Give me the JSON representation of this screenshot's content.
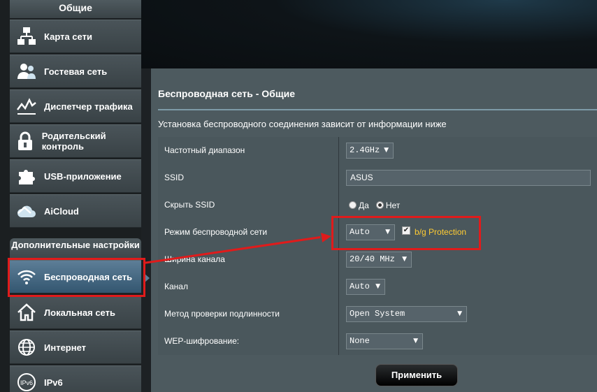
{
  "sidebar": {
    "general_header": "Общие",
    "general_items": [
      {
        "label": "Карта сети",
        "icon": "network-map-icon"
      },
      {
        "label": "Гостевая сеть",
        "icon": "guest-network-icon"
      },
      {
        "label": "Диспетчер трафика",
        "icon": "traffic-manager-icon"
      },
      {
        "label": "Родительский контроль",
        "icon": "lock-icon"
      },
      {
        "label": "USB-приложение",
        "icon": "puzzle-icon"
      },
      {
        "label": "AiCloud",
        "icon": "cloud-icon"
      }
    ],
    "advanced_header": "Дополнительные настройки",
    "advanced_items": [
      {
        "label": "Беспроводная сеть",
        "icon": "wifi-icon",
        "active": true
      },
      {
        "label": "Локальная сеть",
        "icon": "home-icon"
      },
      {
        "label": "Интернет",
        "icon": "globe-icon"
      },
      {
        "label": "IPv6",
        "icon": "ipv6-icon"
      }
    ]
  },
  "panel": {
    "title": "Беспроводная сеть - Общие",
    "description": "Установка беспроводного соединения зависит от информации ниже",
    "rows": {
      "band": {
        "label": "Частотный диапазон",
        "value": "2.4GHz"
      },
      "ssid": {
        "label": "SSID",
        "value": "ASUS"
      },
      "hide_ssid": {
        "label": "Скрыть SSID",
        "option_yes": "Да",
        "option_no": "Нет",
        "selected": "Нет"
      },
      "mode": {
        "label": "Режим беспроводной сети",
        "value": "Auto",
        "protection_label": "b/g Protection",
        "protection_checked": true
      },
      "width": {
        "label": "Ширина канала",
        "value": "20/40 MHz"
      },
      "channel": {
        "label": "Канал",
        "value": "Auto"
      },
      "auth": {
        "label": "Метод проверки подлинности",
        "value": "Open System"
      },
      "wep": {
        "label": "WEP-шифрование:",
        "value": "None"
      }
    },
    "apply_label": "Применить"
  },
  "colors": {
    "annotation_red": "#e01b1b",
    "protection_text": "#ffcc33",
    "active_item": "#335670"
  }
}
